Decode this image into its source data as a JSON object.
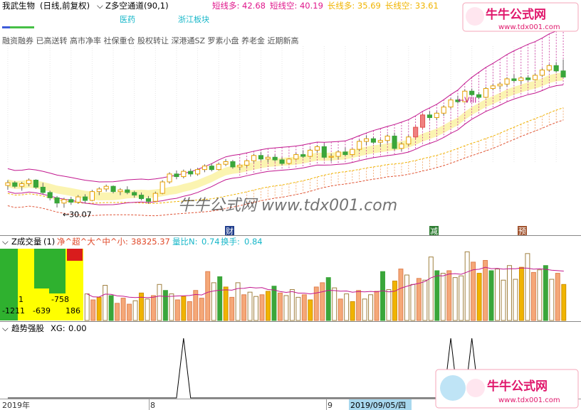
{
  "stock": {
    "title": "我武生物",
    "period": "(日线,前复权)",
    "indicator": "Z多空通道",
    "indicator_params": "(90,1)",
    "readouts": [
      {
        "label": "短线多:",
        "value": "42.68",
        "color": "#e0188c"
      },
      {
        "label": "短线空:",
        "value": "40.19",
        "color": "#e0188c"
      },
      {
        "label": "长线多:",
        "value": "35.69",
        "color": "#f0b400"
      },
      {
        "label": "长线空:",
        "value": "33.61",
        "color": "#f0b400"
      }
    ],
    "sector_tags": [
      "医药",
      "浙江板块"
    ],
    "concepts": "融资融券  已高送转  高市净率  社保重仓  股权转让  深港通SZ  罗素小盘  养老金  近期新高",
    "low_marker": "←30.07",
    "wave_label": "←VIII",
    "event_badges": [
      {
        "text": "财",
        "color": "#1f3d8c"
      },
      {
        "text": "减",
        "color": "#2e7d32"
      },
      {
        "text": "预",
        "color": "#a0522d"
      }
    ]
  },
  "volume_panel": {
    "indicator": "Z成交量",
    "param": "(1)",
    "label_flow": "净^超^大^中^小:",
    "flow_value": "38325.37",
    "ratio_label": "量比N:",
    "ratio_value": "0.74",
    "turnover_label": "换手:",
    "turnover_value": "0.84",
    "flow_numbers_top": [
      "1",
      "-758"
    ],
    "flow_numbers_bottom": [
      "-1211",
      "-639",
      "186"
    ]
  },
  "trend_panel": {
    "indicator": "趋势强股",
    "xg_label": "XG:",
    "xg_value": "0.00"
  },
  "xaxis": {
    "labels": [
      "2019年",
      "8",
      "9",
      "2019/09/05/四"
    ]
  },
  "watermark": {
    "text": "牛牛公式网 www.tdx001.com",
    "logo_title": "牛牛公式网",
    "logo_url": "www.tdx001.com"
  },
  "colors": {
    "up": "#e8a000",
    "down": "#3aa63a",
    "channel_pink": "#c2188f",
    "channel_yellow": "#f5e26a",
    "strong_red": "#f08080"
  },
  "chart_data": [
    {
      "type": "candlestick",
      "title": "我武生物 (日线,前复权)",
      "ylim": [
        28,
        48
      ],
      "low_annotation": 30.07,
      "channel": {
        "short_long": 42.68,
        "short_short": 40.19,
        "long_long": 35.69,
        "long_short": 33.61
      },
      "series": [
        {
          "name": "K",
          "ohlc": [
            [
              32.6,
              33.2,
              32.1,
              32.9
            ],
            [
              32.9,
              33.1,
              32.3,
              32.5
            ],
            [
              32.5,
              33.0,
              32.0,
              32.8
            ],
            [
              32.8,
              33.4,
              32.5,
              33.2
            ],
            [
              33.2,
              33.3,
              32.2,
              32.4
            ],
            [
              32.4,
              32.9,
              31.6,
              31.8
            ],
            [
              31.8,
              32.0,
              30.9,
              31.2
            ],
            [
              31.2,
              31.4,
              30.1,
              30.6
            ],
            [
              30.6,
              31.2,
              30.07,
              31.0
            ],
            [
              31.0,
              31.3,
              30.4,
              30.7
            ],
            [
              30.7,
              31.5,
              30.5,
              31.3
            ],
            [
              31.3,
              31.6,
              30.6,
              30.9
            ],
            [
              30.9,
              32.1,
              30.8,
              31.9
            ],
            [
              31.9,
              32.4,
              31.5,
              32.2
            ],
            [
              32.2,
              32.7,
              31.9,
              32.5
            ],
            [
              32.5,
              32.6,
              31.7,
              31.9
            ],
            [
              31.9,
              32.3,
              31.5,
              32.1
            ],
            [
              32.1,
              32.5,
              31.6,
              31.8
            ],
            [
              31.8,
              32.0,
              31.2,
              31.5
            ],
            [
              31.5,
              31.8,
              30.9,
              31.1
            ],
            [
              31.1,
              31.4,
              30.5,
              30.8
            ],
            [
              30.8,
              31.9,
              30.7,
              31.7
            ],
            [
              31.7,
              33.2,
              31.6,
              33.0
            ],
            [
              33.0,
              34.1,
              32.8,
              33.9
            ],
            [
              33.9,
              34.3,
              33.3,
              33.6
            ],
            [
              33.6,
              34.4,
              33.4,
              34.2
            ],
            [
              34.2,
              34.5,
              33.6,
              33.9
            ],
            [
              33.9,
              34.6,
              33.7,
              34.4
            ],
            [
              34.4,
              35.0,
              34.1,
              34.8
            ],
            [
              34.8,
              35.1,
              34.2,
              34.4
            ],
            [
              34.4,
              35.2,
              34.3,
              35.0
            ],
            [
              35.0,
              35.6,
              34.8,
              35.3
            ],
            [
              35.3,
              35.5,
              34.5,
              34.7
            ],
            [
              34.7,
              35.0,
              34.3,
              34.9
            ],
            [
              34.9,
              35.5,
              34.7,
              35.4
            ],
            [
              35.4,
              36.2,
              35.2,
              36.0
            ],
            [
              36.0,
              36.4,
              35.4,
              35.6
            ],
            [
              35.6,
              36.0,
              35.2,
              35.8
            ],
            [
              35.8,
              36.1,
              35.3,
              35.5
            ],
            [
              35.5,
              35.8,
              34.9,
              35.1
            ],
            [
              35.1,
              35.7,
              35.0,
              35.6
            ],
            [
              35.6,
              36.3,
              35.5,
              36.1
            ],
            [
              36.1,
              36.6,
              35.7,
              35.9
            ],
            [
              35.9,
              36.8,
              35.8,
              36.6
            ],
            [
              36.6,
              37.2,
              36.3,
              37.0
            ],
            [
              37.0,
              37.4,
              35.6,
              35.8
            ],
            [
              35.8,
              36.2,
              35.3,
              35.9
            ],
            [
              35.9,
              36.6,
              35.6,
              36.4
            ],
            [
              36.4,
              36.9,
              35.9,
              36.1
            ],
            [
              36.1,
              36.8,
              36.0,
              36.7
            ],
            [
              36.7,
              37.8,
              36.5,
              37.6
            ],
            [
              37.6,
              38.3,
              37.2,
              37.9
            ],
            [
              37.9,
              38.1,
              37.3,
              37.5
            ],
            [
              37.5,
              37.9,
              37.0,
              37.7
            ],
            [
              37.7,
              38.4,
              37.4,
              38.2
            ],
            [
              38.2,
              38.6,
              36.6,
              36.8
            ],
            [
              36.8,
              37.5,
              36.5,
              37.3
            ],
            [
              37.3,
              38.3,
              37.1,
              38.1
            ],
            [
              38.1,
              39.4,
              37.9,
              39.2
            ],
            [
              39.2,
              40.8,
              39.0,
              40.6
            ],
            [
              40.6,
              41.0,
              40.0,
              40.3
            ],
            [
              40.3,
              41.0,
              40.0,
              40.8
            ],
            [
              40.8,
              41.7,
              40.5,
              41.5
            ],
            [
              41.5,
              42.5,
              41.3,
              42.3
            ],
            [
              42.3,
              42.8,
              41.9,
              42.1
            ],
            [
              42.1,
              43.5,
              42.0,
              43.3
            ],
            [
              43.3,
              43.6,
              42.7,
              42.9
            ],
            [
              42.9,
              43.2,
              42.4,
              42.6
            ],
            [
              42.6,
              43.8,
              42.5,
              43.6
            ],
            [
              43.6,
              44.1,
              43.4,
              43.9
            ],
            [
              43.9,
              44.3,
              43.5,
              44.1
            ],
            [
              44.1,
              44.9,
              43.8,
              44.7
            ],
            [
              44.7,
              45.2,
              44.3,
              44.5
            ],
            [
              44.5,
              45.0,
              44.1,
              44.8
            ],
            [
              44.8,
              45.1,
              44.4,
              44.6
            ],
            [
              44.6,
              45.3,
              44.5,
              45.1
            ],
            [
              45.1,
              45.9,
              44.9,
              45.7
            ],
            [
              45.7,
              46.4,
              45.5,
              46.2
            ],
            [
              46.2,
              46.6,
              45.4,
              45.6
            ],
            [
              45.6,
              46.9,
              45.2,
              44.9
            ]
          ]
        }
      ]
    },
    {
      "type": "bar",
      "title": "Z成交量(1)",
      "readouts": {
        "flow": 38325.37,
        "volume_ratio": 0.74,
        "turnover": 0.84
      },
      "series": [
        {
          "name": "volume",
          "values": [
            31,
            24,
            27,
            41,
            29,
            20,
            26,
            19,
            23,
            32,
            25,
            29,
            42,
            35,
            31,
            24,
            28,
            22,
            35,
            26,
            57,
            44,
            51,
            39,
            27,
            44,
            30,
            33,
            28,
            30,
            34,
            40,
            32,
            29,
            36,
            27,
            30,
            24,
            39,
            44,
            50,
            38,
            25,
            31,
            22,
            35,
            25,
            30,
            34,
            57,
            36,
            46,
            60,
            53,
            42,
            49,
            47,
            74,
            58,
            55,
            58,
            50,
            52,
            80,
            68,
            55,
            70,
            58,
            60,
            47,
            64,
            48,
            62,
            78,
            56,
            59,
            64,
            48,
            55,
            42
          ]
        }
      ]
    },
    {
      "type": "line",
      "title": "趋势强股",
      "readouts": {
        "XG": 0.0
      },
      "series": [
        {
          "name": "XG",
          "values": [
            0,
            0,
            0,
            0,
            0,
            0,
            0,
            0,
            0,
            0,
            0,
            0,
            0,
            0,
            0,
            0,
            0,
            0,
            0,
            0,
            0,
            0,
            0,
            0,
            0,
            1,
            0,
            0,
            0,
            0,
            0,
            0,
            0,
            0,
            0,
            0,
            0,
            0,
            0,
            0,
            0,
            0,
            0,
            0,
            0,
            0,
            0,
            0,
            0,
            0,
            0,
            0,
            0,
            0,
            0,
            0,
            0,
            0,
            0,
            0,
            0,
            0,
            0,
            1,
            0,
            0,
            1,
            0,
            0,
            0,
            0,
            0,
            0,
            0,
            0,
            0,
            0,
            0,
            0,
            0
          ]
        }
      ]
    }
  ]
}
